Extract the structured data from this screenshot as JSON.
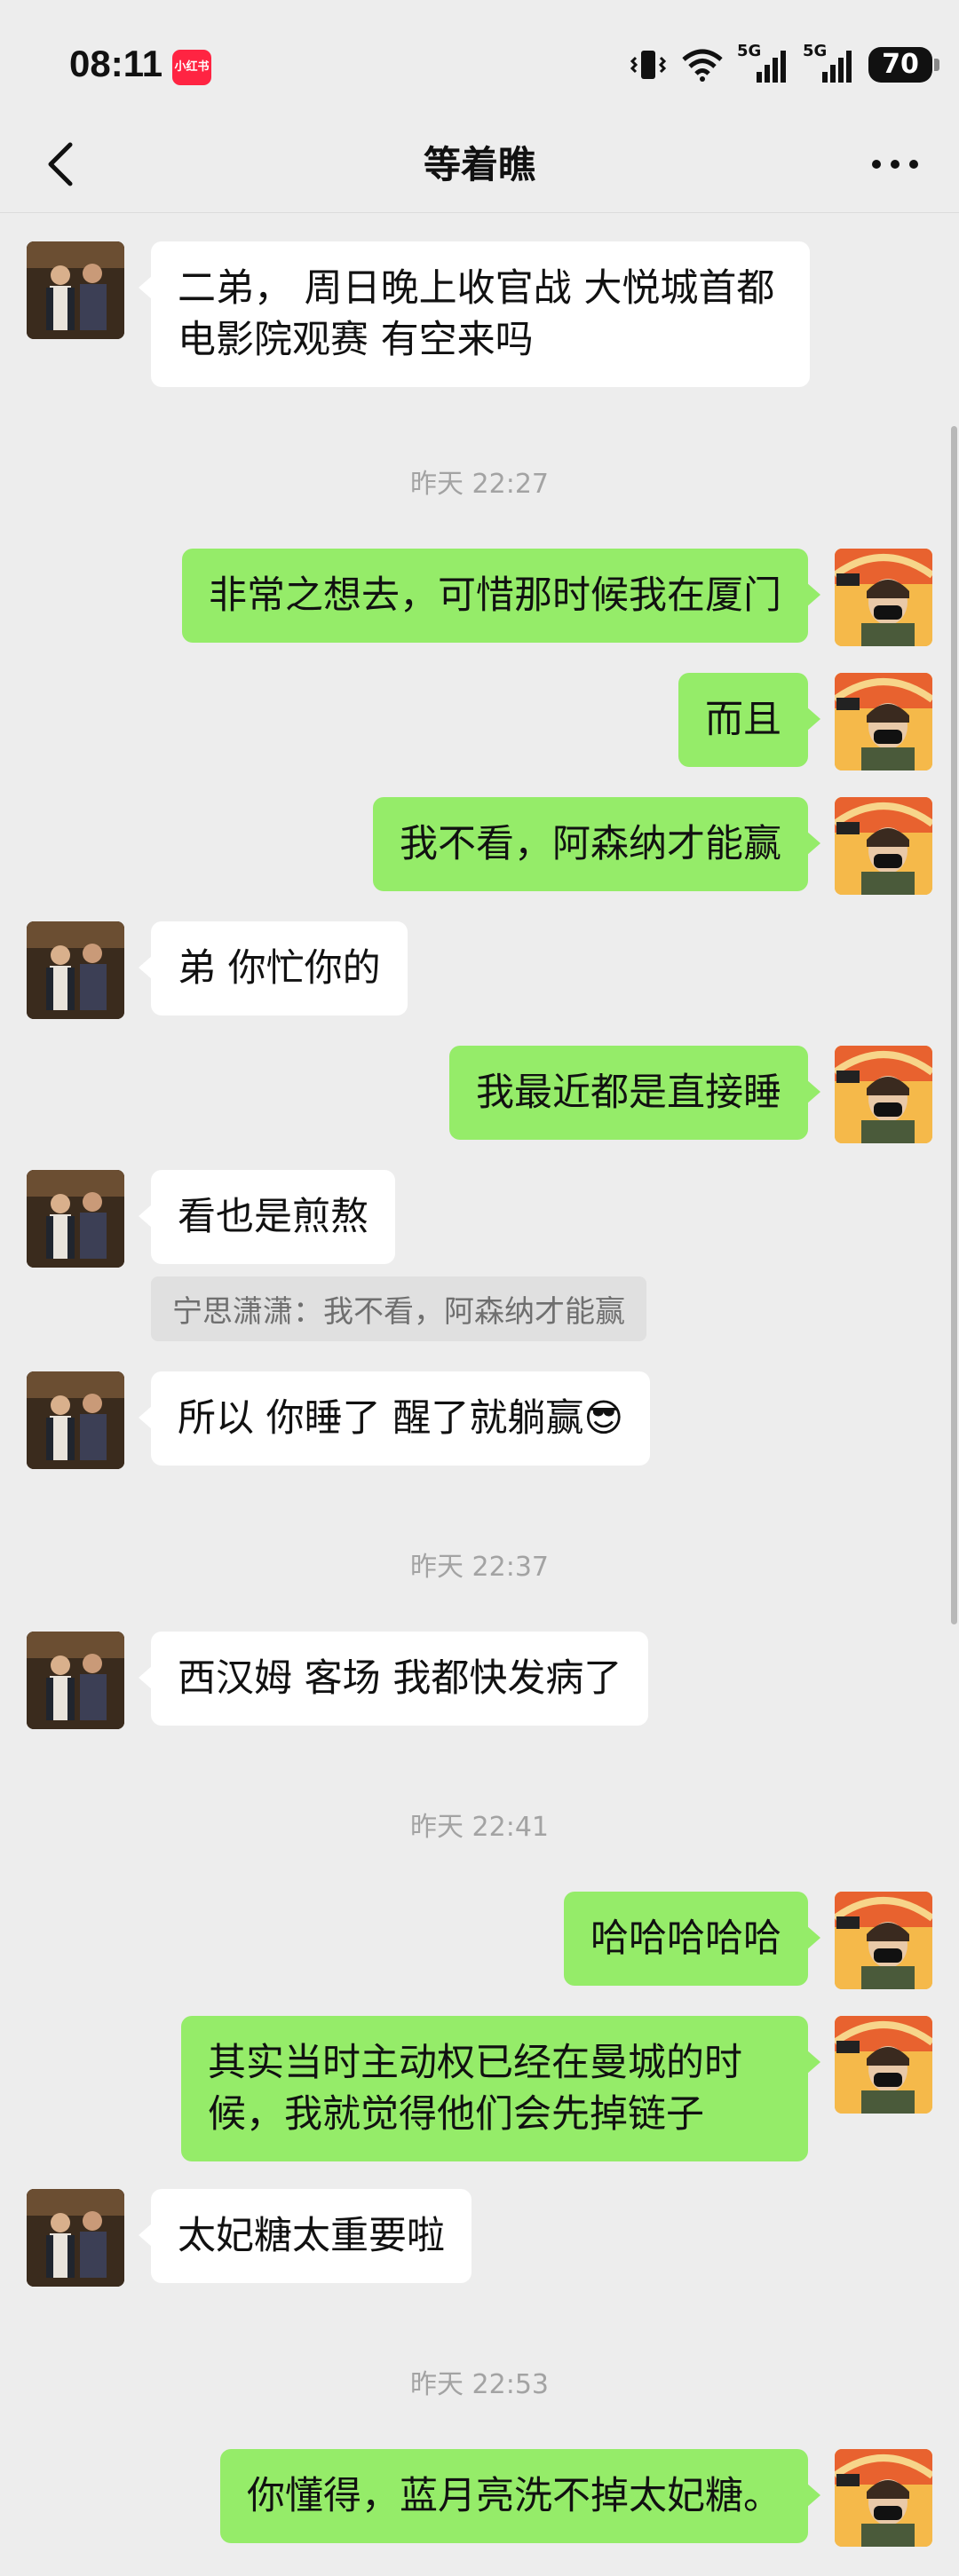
{
  "status_bar": {
    "time": "08:11",
    "app_badge": "小红书",
    "network_1": "5G",
    "network_2": "5G",
    "battery": "70"
  },
  "header": {
    "title": "等着瞧",
    "back_icon": "chevron-left-icon",
    "more_icon": "more-dots-icon"
  },
  "messages": [
    {
      "sender": "friend",
      "text": "二弟， 周日晚上收官战  大悦城首都电影院观赛  有空来吗"
    },
    {
      "type": "timestamp",
      "text": "昨天 22:27"
    },
    {
      "sender": "me",
      "text": "非常之想去，可惜那时候我在厦门"
    },
    {
      "sender": "me",
      "text": "而且"
    },
    {
      "sender": "me",
      "text": "我不看，阿森纳才能赢"
    },
    {
      "sender": "friend",
      "text": "弟 你忙你的"
    },
    {
      "sender": "me",
      "text": "我最近都是直接睡"
    },
    {
      "sender": "friend",
      "text": "看也是煎熬"
    },
    {
      "type": "quote",
      "text": "宁思潇潇：我不看，阿森纳才能赢"
    },
    {
      "sender": "friend",
      "text": "所以  你睡了  醒了就躺赢😎"
    },
    {
      "type": "timestamp",
      "text": "昨天 22:37"
    },
    {
      "sender": "friend",
      "text": "西汉姆 客场 我都快发病了"
    },
    {
      "type": "timestamp",
      "text": "昨天 22:41"
    },
    {
      "sender": "me",
      "text": "哈哈哈哈哈"
    },
    {
      "sender": "me",
      "text": "其实当时主动权已经在曼城的时候，我就觉得他们会先掉链子"
    },
    {
      "sender": "friend",
      "text": "太妃糖太重要啦"
    },
    {
      "type": "timestamp",
      "text": "昨天 22:53"
    },
    {
      "sender": "me",
      "text": "你懂得，蓝月亮洗不掉太妃糖。"
    }
  ],
  "colors": {
    "background": "#ededed",
    "my_bubble": "#95ec69",
    "friend_bubble": "#ffffff"
  }
}
